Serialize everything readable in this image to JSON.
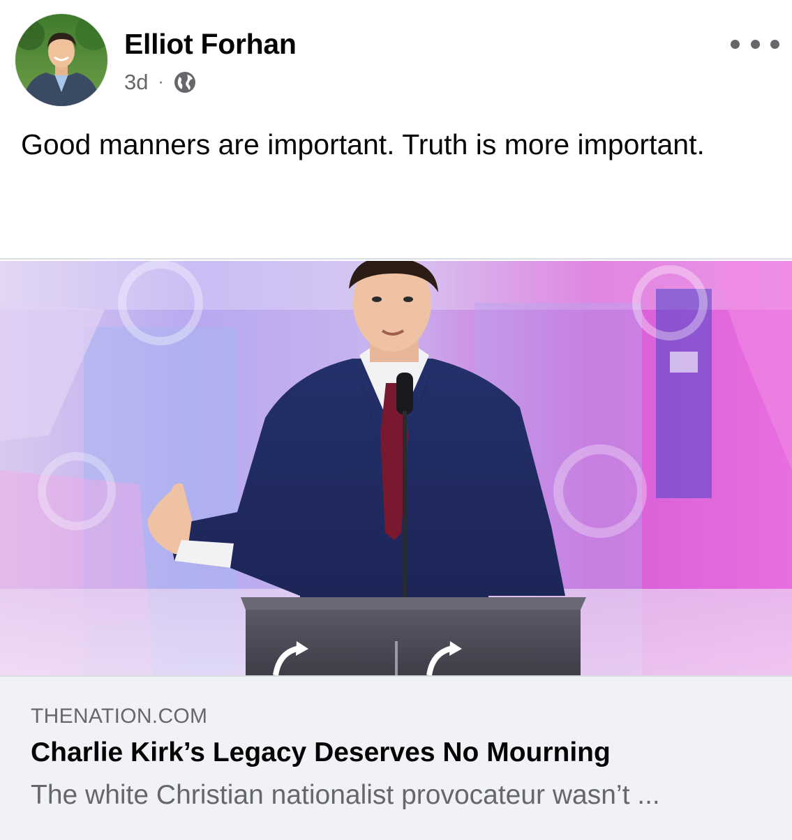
{
  "post": {
    "author": "Elliot Forhan",
    "time": "3d",
    "separator": "·",
    "privacy_icon": "globe-icon",
    "avatar_icon": "profile-photo",
    "more_icon": "more-options-icon",
    "text": "Good manners are important. Truth is more important."
  },
  "link_preview": {
    "domain": "THENATION.COM",
    "title": "Charlie Kirk’s Legacy Deserves No Mourning",
    "description": "The white Christian nationalist provocateur wasn’t ..."
  },
  "colors": {
    "text_primary": "#050505",
    "text_secondary": "#65676b",
    "card_background": "#f0f2f5",
    "border": "#dadde1"
  }
}
